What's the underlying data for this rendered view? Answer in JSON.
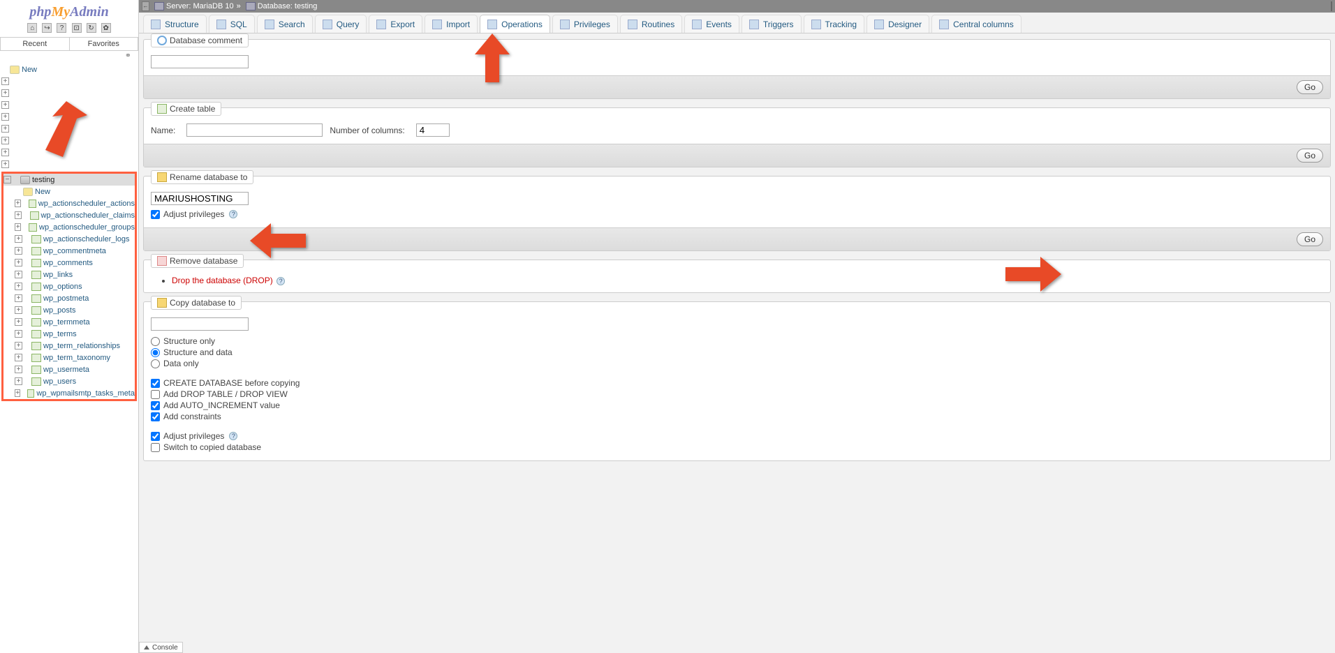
{
  "logo": {
    "php": "php",
    "my": "My",
    "admin": "Admin"
  },
  "sidebar": {
    "recent_label": "Recent",
    "favorites_label": "Favorites",
    "new_top": "New",
    "selected_db": "testing",
    "new_inner": "New",
    "tables": [
      "wp_actionscheduler_actions",
      "wp_actionscheduler_claims",
      "wp_actionscheduler_groups",
      "wp_actionscheduler_logs",
      "wp_commentmeta",
      "wp_comments",
      "wp_links",
      "wp_options",
      "wp_postmeta",
      "wp_posts",
      "wp_termmeta",
      "wp_terms",
      "wp_term_relationships",
      "wp_term_taxonomy",
      "wp_usermeta",
      "wp_users",
      "wp_wpmailsmtp_tasks_meta"
    ]
  },
  "breadcrumb": {
    "server_label": "Server: MariaDB 10",
    "db_label": "Database: testing"
  },
  "tabs": [
    {
      "id": "structure",
      "label": "Structure"
    },
    {
      "id": "sql",
      "label": "SQL"
    },
    {
      "id": "search",
      "label": "Search"
    },
    {
      "id": "query",
      "label": "Query"
    },
    {
      "id": "export",
      "label": "Export"
    },
    {
      "id": "import",
      "label": "Import"
    },
    {
      "id": "operations",
      "label": "Operations"
    },
    {
      "id": "privileges",
      "label": "Privileges"
    },
    {
      "id": "routines",
      "label": "Routines"
    },
    {
      "id": "events",
      "label": "Events"
    },
    {
      "id": "triggers",
      "label": "Triggers"
    },
    {
      "id": "tracking",
      "label": "Tracking"
    },
    {
      "id": "designer",
      "label": "Designer"
    },
    {
      "id": "central",
      "label": "Central columns"
    }
  ],
  "active_tab": "operations",
  "panels": {
    "comment": {
      "legend": "Database comment",
      "value": ""
    },
    "create": {
      "legend": "Create table",
      "name_label": "Name:",
      "name_value": "",
      "cols_label": "Number of columns:",
      "cols_value": "4"
    },
    "rename": {
      "legend": "Rename database to",
      "value": "MARIUSHOSTING",
      "adjust_label": "Adjust privileges",
      "adjust_checked": true
    },
    "remove": {
      "legend": "Remove database",
      "drop_text": "Drop the database (DROP)"
    },
    "copy": {
      "legend": "Copy database to",
      "value": "",
      "opt_structure_only": "Structure only",
      "opt_structure_data": "Structure and data",
      "opt_data_only": "Data only",
      "cb_create_before": "CREATE DATABASE before copying",
      "cb_drop": "Add DROP TABLE / DROP VIEW",
      "cb_autoinc": "Add AUTO_INCREMENT value",
      "cb_constraints": "Add constraints",
      "cb_adjust": "Adjust privileges",
      "cb_switch": "Switch to copied database"
    }
  },
  "go_label": "Go",
  "console_label": "Console"
}
